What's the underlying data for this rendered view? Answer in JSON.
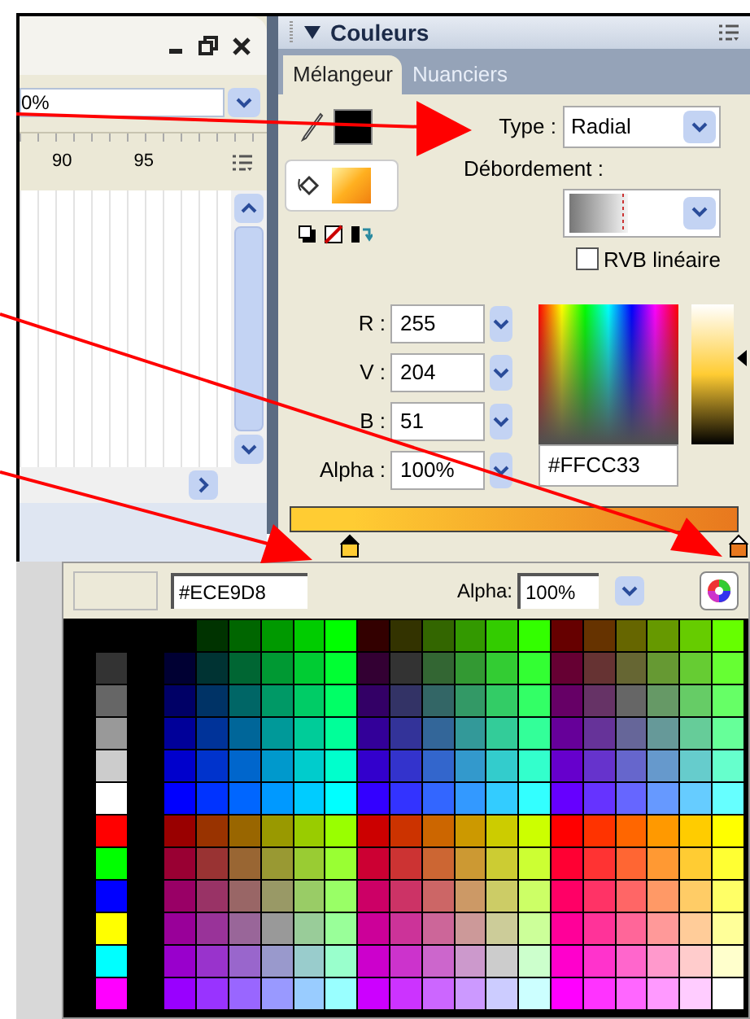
{
  "timeline_panel": {
    "zoom_value": "0%",
    "ruler_labels": [
      "90",
      "95"
    ]
  },
  "color_panel": {
    "title": "Couleurs",
    "tabs": [
      {
        "label": "Mélangeur",
        "selected": true
      },
      {
        "label": "Nuanciers",
        "selected": false
      }
    ],
    "stroke_swatch": {
      "color": "#000000"
    },
    "type_label": "Type :",
    "type_value": "Radial",
    "overflow_label": "Débordement :",
    "linear_rgb": {
      "label": "RVB linéaire",
      "checked": false
    },
    "channels": [
      {
        "label": "R :",
        "value": "255"
      },
      {
        "label": "V :",
        "value": "204"
      },
      {
        "label": "B :",
        "value": "51"
      },
      {
        "label": "Alpha :",
        "value": "100%"
      }
    ],
    "hex_value": "#FFCC33",
    "brightness": {
      "level": 0.62
    },
    "gradient_stops": [
      {
        "color": "#ffcc33",
        "selected": true
      },
      {
        "color": "#e8781e",
        "selected": false
      }
    ]
  },
  "swatch_popup": {
    "preview": {
      "color": "#ece9d8"
    },
    "hex_value": "#ECE9D8",
    "alpha_label": "Alpha:",
    "alpha_value": "100%",
    "gray_column": [
      {
        "color": "#333333"
      },
      {
        "color": "#666666"
      },
      {
        "color": "#999999"
      },
      {
        "color": "#cccccc"
      },
      {
        "color": "#ffffff"
      },
      {
        "color": "#ff0000"
      },
      {
        "color": "#00ff00"
      },
      {
        "color": "#0000ff"
      },
      {
        "color": "#ffff00"
      },
      {
        "color": "#00ffff"
      },
      {
        "color": "#ff00ff"
      }
    ],
    "rows": [
      {
        "swatches": [
          {
            "color": "#003300"
          },
          {
            "color": "#006600"
          },
          {
            "color": "#009900"
          },
          {
            "color": "#00cc00"
          },
          {
            "color": "#00ff00"
          },
          {
            "color": "#330000"
          },
          {
            "color": "#333300"
          },
          {
            "color": "#336600"
          },
          {
            "color": "#339900"
          },
          {
            "color": "#33cc00"
          },
          {
            "color": "#33ff00"
          },
          {
            "color": "#660000"
          },
          {
            "color": "#663300"
          },
          {
            "color": "#666600"
          },
          {
            "color": "#669900"
          },
          {
            "color": "#66cc00"
          },
          {
            "color": "#66ff00"
          }
        ]
      },
      {
        "swatches": [
          {
            "color": "#000033"
          },
          {
            "color": "#003333"
          },
          {
            "color": "#006633"
          },
          {
            "color": "#009933"
          },
          {
            "color": "#00cc33"
          },
          {
            "color": "#00ff33"
          },
          {
            "color": "#330033"
          },
          {
            "color": "#333333"
          },
          {
            "color": "#336633"
          },
          {
            "color": "#339933"
          },
          {
            "color": "#33cc33"
          },
          {
            "color": "#33ff33"
          },
          {
            "color": "#660033"
          },
          {
            "color": "#663333"
          },
          {
            "color": "#666633"
          },
          {
            "color": "#669933"
          },
          {
            "color": "#66cc33"
          },
          {
            "color": "#66ff33"
          }
        ]
      },
      {
        "swatches": [
          {
            "color": "#000066"
          },
          {
            "color": "#003366"
          },
          {
            "color": "#006666"
          },
          {
            "color": "#009966"
          },
          {
            "color": "#00cc66"
          },
          {
            "color": "#00ff66"
          },
          {
            "color": "#330066"
          },
          {
            "color": "#333366"
          },
          {
            "color": "#336666"
          },
          {
            "color": "#339966"
          },
          {
            "color": "#33cc66"
          },
          {
            "color": "#33ff66"
          },
          {
            "color": "#660066"
          },
          {
            "color": "#663366"
          },
          {
            "color": "#666666"
          },
          {
            "color": "#669966"
          },
          {
            "color": "#66cc66"
          },
          {
            "color": "#66ff66"
          }
        ]
      },
      {
        "swatches": [
          {
            "color": "#000099"
          },
          {
            "color": "#003399"
          },
          {
            "color": "#006699"
          },
          {
            "color": "#009999"
          },
          {
            "color": "#00cc99"
          },
          {
            "color": "#00ff99"
          },
          {
            "color": "#330099"
          },
          {
            "color": "#333399"
          },
          {
            "color": "#336699"
          },
          {
            "color": "#339999"
          },
          {
            "color": "#33cc99"
          },
          {
            "color": "#33ff99"
          },
          {
            "color": "#660099"
          },
          {
            "color": "#663399"
          },
          {
            "color": "#666699"
          },
          {
            "color": "#669999"
          },
          {
            "color": "#66cc99"
          },
          {
            "color": "#66ff99"
          }
        ]
      },
      {
        "swatches": [
          {
            "color": "#0000cc"
          },
          {
            "color": "#0033cc"
          },
          {
            "color": "#0066cc"
          },
          {
            "color": "#0099cc"
          },
          {
            "color": "#00cccc"
          },
          {
            "color": "#00ffcc"
          },
          {
            "color": "#3300cc"
          },
          {
            "color": "#3333cc"
          },
          {
            "color": "#3366cc"
          },
          {
            "color": "#3399cc"
          },
          {
            "color": "#33cccc"
          },
          {
            "color": "#33ffcc"
          },
          {
            "color": "#6600cc"
          },
          {
            "color": "#6633cc"
          },
          {
            "color": "#6666cc"
          },
          {
            "color": "#6699cc"
          },
          {
            "color": "#66cccc"
          },
          {
            "color": "#66ffcc"
          }
        ]
      },
      {
        "swatches": [
          {
            "color": "#0000ff"
          },
          {
            "color": "#0033ff"
          },
          {
            "color": "#0066ff"
          },
          {
            "color": "#0099ff"
          },
          {
            "color": "#00ccff"
          },
          {
            "color": "#00ffff"
          },
          {
            "color": "#3300ff"
          },
          {
            "color": "#3333ff"
          },
          {
            "color": "#3366ff"
          },
          {
            "color": "#3399ff"
          },
          {
            "color": "#33ccff"
          },
          {
            "color": "#33ffff"
          },
          {
            "color": "#6600ff"
          },
          {
            "color": "#6633ff"
          },
          {
            "color": "#6666ff"
          },
          {
            "color": "#6699ff"
          },
          {
            "color": "#66ccff"
          },
          {
            "color": "#66ffff"
          }
        ]
      },
      {
        "swatches": [
          {
            "color": "#990000"
          },
          {
            "color": "#993300"
          },
          {
            "color": "#996600"
          },
          {
            "color": "#999900"
          },
          {
            "color": "#99cc00"
          },
          {
            "color": "#99ff00"
          },
          {
            "color": "#cc0000"
          },
          {
            "color": "#cc3300"
          },
          {
            "color": "#cc6600"
          },
          {
            "color": "#cc9900"
          },
          {
            "color": "#cccc00"
          },
          {
            "color": "#ccff00"
          },
          {
            "color": "#ff0000"
          },
          {
            "color": "#ff3300"
          },
          {
            "color": "#ff6600"
          },
          {
            "color": "#ff9900"
          },
          {
            "color": "#ffcc00"
          },
          {
            "color": "#ffff00"
          }
        ]
      },
      {
        "swatches": [
          {
            "color": "#990033"
          },
          {
            "color": "#993333"
          },
          {
            "color": "#996633"
          },
          {
            "color": "#999933"
          },
          {
            "color": "#99cc33"
          },
          {
            "color": "#99ff33"
          },
          {
            "color": "#cc0033"
          },
          {
            "color": "#cc3333"
          },
          {
            "color": "#cc6633"
          },
          {
            "color": "#cc9933"
          },
          {
            "color": "#cccc33"
          },
          {
            "color": "#ccff33"
          },
          {
            "color": "#ff0033"
          },
          {
            "color": "#ff3333"
          },
          {
            "color": "#ff6633"
          },
          {
            "color": "#ff9933"
          },
          {
            "color": "#ffcc33"
          },
          {
            "color": "#ffff33"
          }
        ]
      },
      {
        "swatches": [
          {
            "color": "#990066"
          },
          {
            "color": "#993366"
          },
          {
            "color": "#996666"
          },
          {
            "color": "#999966"
          },
          {
            "color": "#99cc66"
          },
          {
            "color": "#99ff66"
          },
          {
            "color": "#cc0066"
          },
          {
            "color": "#cc3366"
          },
          {
            "color": "#cc6666"
          },
          {
            "color": "#cc9966"
          },
          {
            "color": "#cccc66"
          },
          {
            "color": "#ccff66"
          },
          {
            "color": "#ff0066"
          },
          {
            "color": "#ff3366"
          },
          {
            "color": "#ff6666"
          },
          {
            "color": "#ff9966"
          },
          {
            "color": "#ffcc66"
          },
          {
            "color": "#ffff66"
          }
        ]
      },
      {
        "swatches": [
          {
            "color": "#990099"
          },
          {
            "color": "#993399"
          },
          {
            "color": "#996699"
          },
          {
            "color": "#999999"
          },
          {
            "color": "#99cc99"
          },
          {
            "color": "#99ff99"
          },
          {
            "color": "#cc0099"
          },
          {
            "color": "#cc3399"
          },
          {
            "color": "#cc6699"
          },
          {
            "color": "#cc9999"
          },
          {
            "color": "#cccc99"
          },
          {
            "color": "#ccff99"
          },
          {
            "color": "#ff0099"
          },
          {
            "color": "#ff3399"
          },
          {
            "color": "#ff6699"
          },
          {
            "color": "#ff9999"
          },
          {
            "color": "#ffcc99"
          },
          {
            "color": "#ffff99"
          }
        ]
      },
      {
        "swatches": [
          {
            "color": "#9900cc"
          },
          {
            "color": "#9933cc"
          },
          {
            "color": "#9966cc"
          },
          {
            "color": "#9999cc"
          },
          {
            "color": "#99cccc"
          },
          {
            "color": "#99ffcc"
          },
          {
            "color": "#cc00cc"
          },
          {
            "color": "#cc33cc"
          },
          {
            "color": "#cc66cc"
          },
          {
            "color": "#cc99cc"
          },
          {
            "color": "#cccccc"
          },
          {
            "color": "#ccffcc"
          },
          {
            "color": "#ff00cc"
          },
          {
            "color": "#ff33cc"
          },
          {
            "color": "#ff66cc"
          },
          {
            "color": "#ff99cc"
          },
          {
            "color": "#ffcccc"
          },
          {
            "color": "#ffffcc"
          }
        ]
      },
      {
        "swatches": [
          {
            "color": "#9900ff"
          },
          {
            "color": "#9933ff"
          },
          {
            "color": "#9966ff"
          },
          {
            "color": "#9999ff"
          },
          {
            "color": "#99ccff"
          },
          {
            "color": "#99ffff"
          },
          {
            "color": "#cc00ff"
          },
          {
            "color": "#cc33ff"
          },
          {
            "color": "#cc66ff"
          },
          {
            "color": "#cc99ff"
          },
          {
            "color": "#ccccff"
          },
          {
            "color": "#ccffff"
          },
          {
            "color": "#ff00ff"
          },
          {
            "color": "#ff33ff"
          },
          {
            "color": "#ff66ff"
          },
          {
            "color": "#ff99ff"
          },
          {
            "color": "#ffccff"
          },
          {
            "color": "#ffffff"
          }
        ]
      }
    ]
  }
}
